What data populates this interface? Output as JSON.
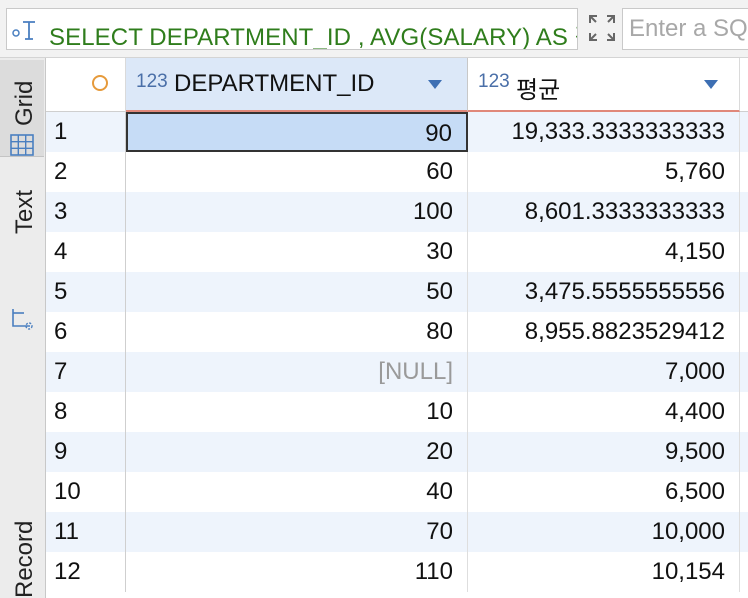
{
  "query_bar": {
    "sql_text": "SELECT DEPARTMENT_ID , AVG(SALARY) AS 평균 FROM EMPLOYEES GROUP BY DEPARTMENT_ID",
    "filter_placeholder": "Enter a SQL expression to filter results"
  },
  "side_tabs": {
    "grid": "Grid",
    "text": "Text",
    "record": "Record"
  },
  "columns": [
    {
      "type_badge": "123",
      "title": "DEPARTMENT_ID"
    },
    {
      "type_badge": "123",
      "title": "평균"
    }
  ],
  "rows": [
    {
      "num": "1",
      "dept": "90",
      "avg": "19,333.3333333333"
    },
    {
      "num": "2",
      "dept": "60",
      "avg": "5,760"
    },
    {
      "num": "3",
      "dept": "100",
      "avg": "8,601.3333333333"
    },
    {
      "num": "4",
      "dept": "30",
      "avg": "4,150"
    },
    {
      "num": "5",
      "dept": "50",
      "avg": "3,475.5555555556"
    },
    {
      "num": "6",
      "dept": "80",
      "avg": "8,955.8823529412"
    },
    {
      "num": "7",
      "dept": "[NULL]",
      "avg": "7,000"
    },
    {
      "num": "8",
      "dept": "10",
      "avg": "4,400"
    },
    {
      "num": "9",
      "dept": "20",
      "avg": "9,500"
    },
    {
      "num": "10",
      "dept": "40",
      "avg": "6,500"
    },
    {
      "num": "11",
      "dept": "70",
      "avg": "10,000"
    },
    {
      "num": "12",
      "dept": "110",
      "avg": "10,154"
    }
  ],
  "colors": {
    "sql_text": "#2f7d1c",
    "header_selected": "#dce8f8",
    "row_alt": "#eef4fc",
    "null_text": "#9a9a9a",
    "accent_line": "#e0887a"
  }
}
